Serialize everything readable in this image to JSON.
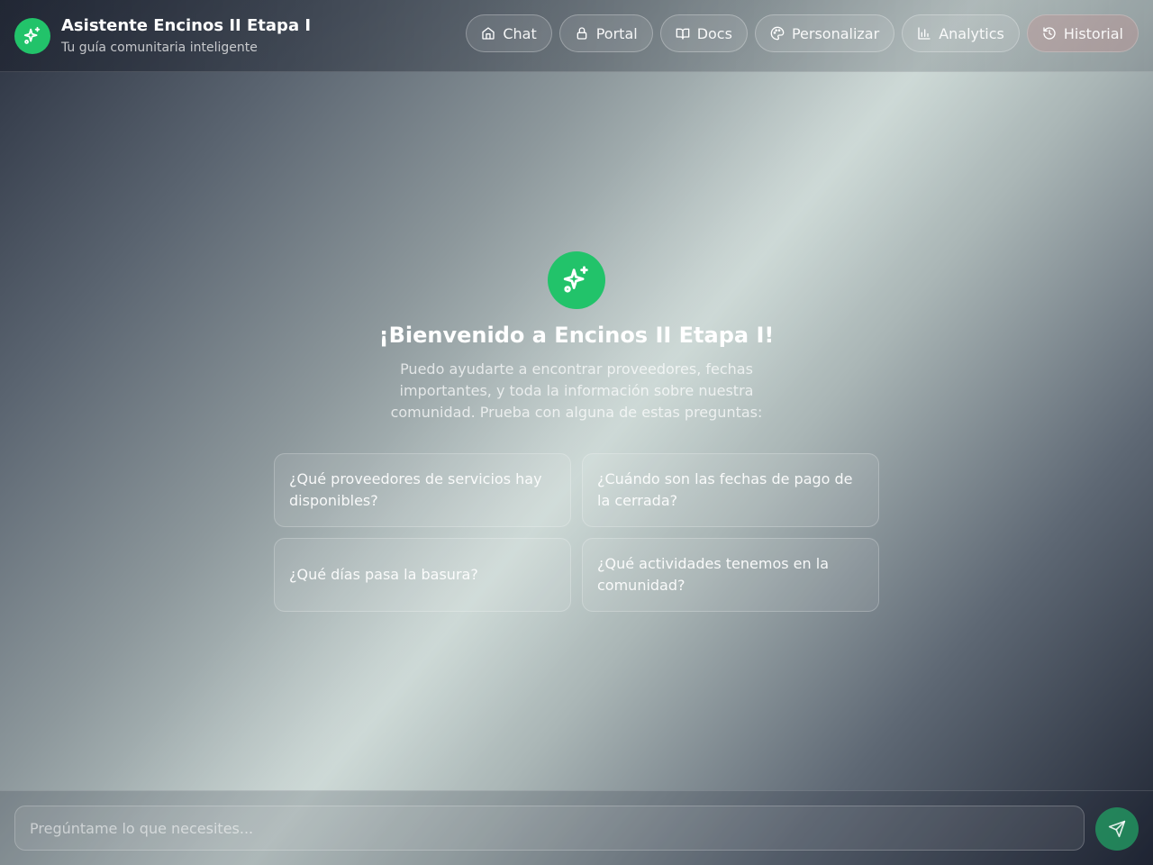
{
  "header": {
    "title": "Asistente Encinos II Etapa I",
    "subtitle": "Tu guía comunitaria inteligente",
    "logo_icon": "sparkles-icon",
    "nav": [
      {
        "label": "Chat",
        "icon": "home-icon"
      },
      {
        "label": "Portal",
        "icon": "lock-icon"
      },
      {
        "label": "Docs",
        "icon": "book-icon"
      },
      {
        "label": "Personalizar",
        "icon": "palette-icon"
      },
      {
        "label": "Analytics",
        "icon": "bar-chart-icon"
      },
      {
        "label": "Historial",
        "icon": "history-icon",
        "active": true
      }
    ]
  },
  "welcome": {
    "icon": "sparkles-icon",
    "title": "¡Bienvenido a Encinos II Etapa I!",
    "text": "Puedo ayudarte a encontrar proveedores, fechas importantes, y toda la información sobre nuestra comunidad. Prueba con alguna de estas preguntas:"
  },
  "suggestions": [
    "¿Qué proveedores de servicios hay disponibles?",
    "¿Cuándo son las fechas de pago de la cerrada?",
    "¿Qué días pasa la basura?",
    "¿Qué actividades tenemos en la comunidad?"
  ],
  "input": {
    "placeholder": "Pregúntame lo que necesites...",
    "value": "",
    "send_icon": "send-icon"
  },
  "colors": {
    "accent": "#22c36a",
    "active_tab": "#be9696"
  }
}
